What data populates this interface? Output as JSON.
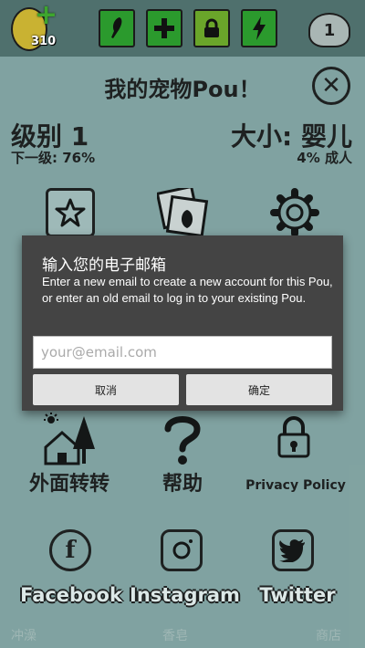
{
  "topbar": {
    "coin_count": "310",
    "pou_level": "1",
    "colors": {
      "bar": "#4f706d",
      "button": "#2b9a2d"
    },
    "buttons": [
      "pen-icon",
      "plus-icon",
      "lock-icon",
      "lightning-icon"
    ]
  },
  "panel": {
    "title": "我的宠物Pou！",
    "level_label": "级别 1",
    "next_level": "下一级: 76%",
    "size_label": "大小: 婴儿",
    "adult_progress": "4% 成人",
    "adult_progress_value": 0.04,
    "next_level_value": 0.76,
    "items": {
      "outside": "外面转转",
      "help": "帮助",
      "privacy": "Privacy Policy",
      "facebook": "Facebook",
      "instagram": "Instagram",
      "twitter": "Twitter"
    },
    "bottom_tabs": [
      "冲澡",
      "香皂",
      "商店"
    ]
  },
  "dialog": {
    "title": "输入您的电子邮箱",
    "message": "Enter a new email to create a new account for this Pou, or enter an old email to log in to your existing Pou.",
    "email_placeholder": "your@email.com",
    "cancel_label": "取消",
    "ok_label": "确定"
  }
}
